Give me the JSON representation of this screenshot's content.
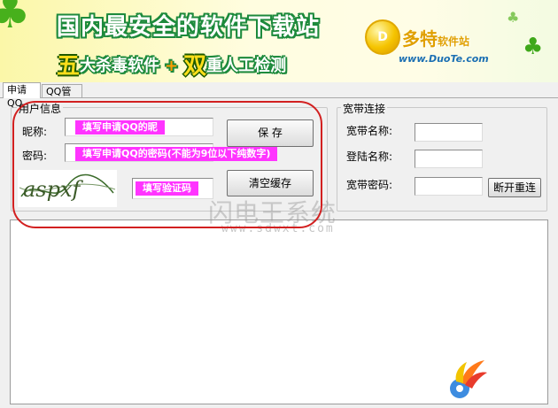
{
  "banner": {
    "slogan_line1": "国内最安全的软件下载站",
    "slogan_line2_a": "五",
    "slogan_line2_b": "大杀毒软件",
    "slogan_line2_plus": "+",
    "slogan_line2_c": "双",
    "slogan_line2_d": "重人工检测",
    "logo_letter": "D",
    "logo_name": "多特",
    "logo_suffix": "软件站",
    "logo_url": "www.DuoTe.com"
  },
  "tabs": [
    {
      "label": "申请QQ",
      "active": true
    },
    {
      "label": "QQ管理",
      "active": false
    }
  ],
  "user_group": {
    "title": "用户信息",
    "nickname_label": "昵称:",
    "password_label": "密码:",
    "nickname_hint": "填写申请QQ的昵",
    "password_hint": "填写申请QQ的密码(不能为9位以下纯数字)",
    "captcha_hint": "填写验证码",
    "captcha_text": "aspxf",
    "save_button": "保 存",
    "clear_cache_button": "清空缓存"
  },
  "broadband_group": {
    "title": "宽带连接",
    "name_label": "宽带名称:",
    "login_label": "登陆名称:",
    "password_label": "宽带密码:",
    "reconnect_button": "断开重连"
  },
  "watermark": {
    "title": "闪电王系统",
    "url": "www.sdwxt.com"
  },
  "colors": {
    "hint_background": "#ff34ff",
    "annotation_ring": "#d22020",
    "banner_green": "#1d8a3c"
  }
}
